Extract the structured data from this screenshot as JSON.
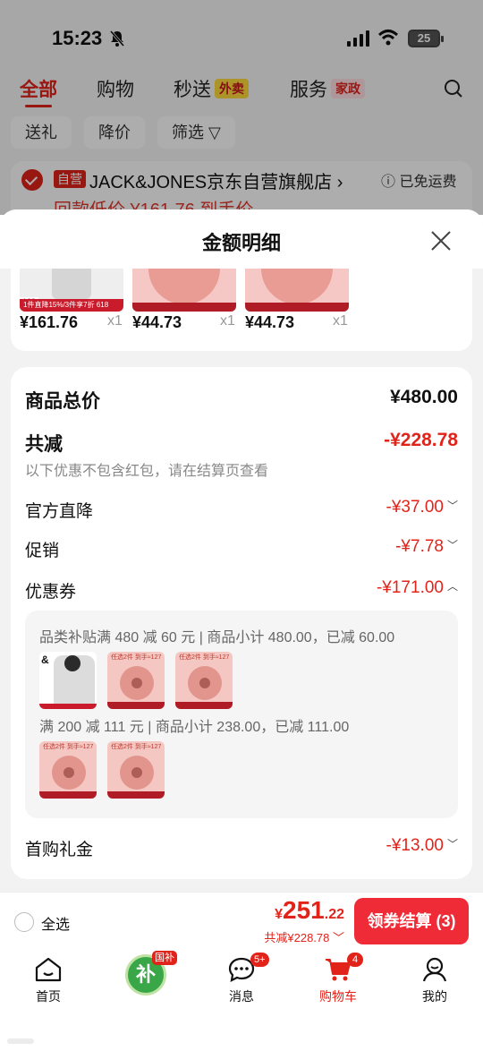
{
  "status": {
    "time": "15:23",
    "battery": "25"
  },
  "top_tabs": [
    {
      "label": "全部",
      "badge": ""
    },
    {
      "label": "购物",
      "badge": ""
    },
    {
      "label": "秒送",
      "badge": "外卖"
    },
    {
      "label": "服务",
      "badge": "家政"
    }
  ],
  "chips": [
    "送礼",
    "降价",
    "筛选"
  ],
  "shop": {
    "tag": "自营",
    "name": "JACK&JONES京东自营旗舰店",
    "free_shipping": "已免运费",
    "peek_text": "回款低价  ¥161.76  到手价"
  },
  "sheet": {
    "title": "金额明细",
    "items": [
      {
        "price": "¥161.76",
        "qty": "x1",
        "thumb_tag": "1件直降15%/3件享7折",
        "thumb_price": "169",
        "thumb_badge": "618"
      },
      {
        "price": "¥44.73",
        "qty": "x1"
      },
      {
        "price": "¥44.73",
        "qty": "x1"
      }
    ],
    "total": {
      "label": "商品总价",
      "value": "¥480.00"
    },
    "discount": {
      "label": "共减",
      "value": "-¥228.78",
      "note": "以下优惠不包含红包，请在结算页查看"
    },
    "rows": [
      {
        "label": "官方直降",
        "value": "-¥37.00"
      },
      {
        "label": "促销",
        "value": "-¥7.78"
      },
      {
        "label": "优惠券",
        "value": "-¥171.00"
      }
    ],
    "coupon_lines": [
      "品类补贴满 480 减 60 元 | 商品小计 480.00，已减 60.00",
      "满 200 减 111 元 | 商品小计 238.00，已减 111.00"
    ],
    "coupon_thumb_tag": "任选2件 到手≈127",
    "gift": {
      "label": "首购礼金",
      "value": "-¥13.00"
    }
  },
  "checkout": {
    "select_all": "全选",
    "currency": "¥",
    "price_int": "251",
    "price_dec": ".22",
    "saved": "共减¥228.78",
    "button": "领券结算 (3)"
  },
  "tabbar": [
    {
      "label": "首页",
      "badge": "",
      "icon": "home-icon"
    },
    {
      "label": "",
      "badge": "国补",
      "icon": "subsidy-icon",
      "center_text": "补"
    },
    {
      "label": "消息",
      "badge": "5+",
      "icon": "message-icon"
    },
    {
      "label": "购物车",
      "badge": "4",
      "icon": "cart-icon"
    },
    {
      "label": "我的",
      "badge": "",
      "icon": "profile-icon"
    }
  ],
  "colors": {
    "accent": "#e2231a",
    "button": "#ef2b38",
    "subsidy_green": "#39a747"
  }
}
